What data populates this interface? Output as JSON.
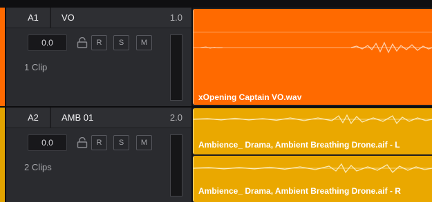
{
  "colors": {
    "vo_accent": "#ff6a00",
    "amb_accent": "#e2a300",
    "vo_clip": "#ff6a00",
    "amb_clip": "#eaa800"
  },
  "tracks": [
    {
      "id": "A1",
      "name": "VO",
      "number": "1.0",
      "volume": "0.0",
      "clip_count": "1 Clip",
      "buttons": [
        "R",
        "S",
        "M"
      ],
      "lock_icon": "lock-icon",
      "clips": [
        {
          "name": "xOpening Captain VO.wav"
        }
      ]
    },
    {
      "id": "A2",
      "name": "AMB 01",
      "number": "2.0",
      "volume": "0.0",
      "clip_count": "2 Clips",
      "buttons": [
        "R",
        "S",
        "M"
      ],
      "lock_icon": "lock-icon",
      "clips": [
        {
          "name": "Ambience_ Drama, Ambient Breathing Drone.aif - L"
        },
        {
          "name": "Ambience_ Drama, Ambient Breathing Drone.aif - R"
        }
      ]
    }
  ]
}
